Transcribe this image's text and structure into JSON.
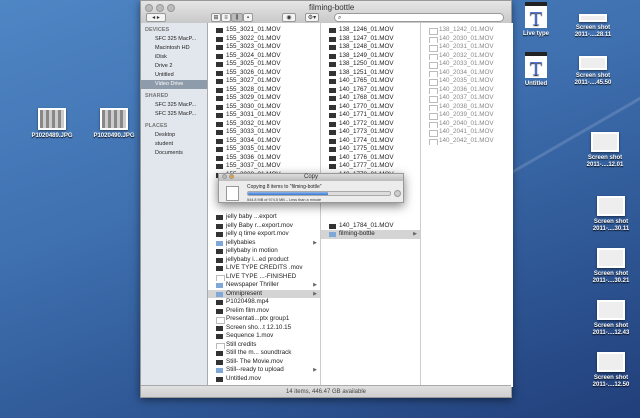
{
  "window": {
    "title": "filming-bottle",
    "status": "14 items, 446.47 GB available"
  },
  "sidebar": {
    "sections": [
      {
        "header": "DEVICES",
        "items": [
          "SFC 325 MacP...",
          "Macintosh HD",
          "iDisk",
          "Drive 2",
          "Untitled",
          "Video Drive"
        ],
        "selected": 5
      },
      {
        "header": "SHARED",
        "items": [
          "SFC 325 MacP...",
          "SFC 325 MacP..."
        ]
      },
      {
        "header": "PLACES",
        "items": [
          "Desktop",
          "student",
          "Documents"
        ]
      }
    ]
  },
  "columns": [
    {
      "rows": [
        {
          "i": 0,
          "t": "155_3021_01.MOV"
        },
        {
          "i": 1,
          "t": "155_3022_01.MOV"
        },
        {
          "i": 2,
          "t": "155_3023_01.MOV"
        },
        {
          "i": 3,
          "t": "155_3024_01.MOV"
        },
        {
          "i": 4,
          "t": "155_3025_01.MOV"
        },
        {
          "i": 5,
          "t": "155_3026_01.MOV"
        },
        {
          "i": 6,
          "t": "155_3027_01.MOV"
        },
        {
          "i": 7,
          "t": "155_3028_01.MOV"
        },
        {
          "i": 8,
          "t": "155_3029_01.MOV"
        },
        {
          "i": 9,
          "t": "155_3030_01.MOV"
        },
        {
          "i": 10,
          "t": "155_3031_01.MOV"
        },
        {
          "i": 11,
          "t": "155_3032_01.MOV"
        },
        {
          "i": 12,
          "t": "155_3033_01.MOV"
        },
        {
          "i": 13,
          "t": "155_3034_01.MOV"
        },
        {
          "i": 14,
          "t": "155_3035_01.MOV"
        },
        {
          "i": 15,
          "t": "155_3036_01.MOV"
        },
        {
          "i": 16,
          "t": "155_3037_01.MOV"
        },
        {
          "i": 17,
          "t": "155_3038_01.MOV"
        },
        {
          "i": 22,
          "t": "jelly baby ...export"
        },
        {
          "i": 23,
          "t": "jelly Baby r...export.mov"
        },
        {
          "i": 24,
          "t": "jelly q time export.mov"
        },
        {
          "i": 25,
          "t": "jellybabies",
          "folder": true
        },
        {
          "i": 26,
          "t": "jellybaby in motion"
        },
        {
          "i": 27,
          "t": "jellybaby i...ed product"
        },
        {
          "i": 28,
          "t": "LIVE TYPE CREDITS .mov"
        },
        {
          "i": 29,
          "t": "LIVE TYPE ...-FINISHED",
          "doc": true
        },
        {
          "i": 30,
          "t": "Newspaper Thriller",
          "folder": true
        },
        {
          "i": 31,
          "t": "Omnipresent",
          "folder": true,
          "sel": true
        },
        {
          "i": 32,
          "t": "P1020498.mp4"
        },
        {
          "i": 33,
          "t": "Prelim film.mov"
        },
        {
          "i": 34,
          "t": "Presentati...ptx group1",
          "doc": true
        },
        {
          "i": 35,
          "t": "Screen sho...t 12.10.15"
        },
        {
          "i": 36,
          "t": "Sequence 1.mov"
        },
        {
          "i": 37,
          "t": "Still credits",
          "doc": true
        },
        {
          "i": 38,
          "t": "Still the m... soundtrack"
        },
        {
          "i": 39,
          "t": "Still- The Movie.mov"
        },
        {
          "i": 40,
          "t": "Still--ready to upload",
          "folder": true
        },
        {
          "i": 41,
          "t": "Untitled.mov"
        }
      ]
    },
    {
      "rows": [
        {
          "i": 0,
          "t": "138_1246_01.MOV"
        },
        {
          "i": 1,
          "t": "138_1247_01.MOV"
        },
        {
          "i": 2,
          "t": "138_1248_01.MOV"
        },
        {
          "i": 3,
          "t": "138_1249_01.MOV"
        },
        {
          "i": 4,
          "t": "138_1250_01.MOV"
        },
        {
          "i": 5,
          "t": "138_1251_01.MOV"
        },
        {
          "i": 6,
          "t": "140_1765_01.MOV"
        },
        {
          "i": 7,
          "t": "140_1767_01.MOV"
        },
        {
          "i": 8,
          "t": "140_1768_01.MOV"
        },
        {
          "i": 9,
          "t": "140_1770_01.MOV"
        },
        {
          "i": 10,
          "t": "140_1771_01.MOV"
        },
        {
          "i": 11,
          "t": "140_1772_01.MOV"
        },
        {
          "i": 12,
          "t": "140_1773_01.MOV"
        },
        {
          "i": 13,
          "t": "140_1774_01.MOV"
        },
        {
          "i": 14,
          "t": "140_1775_01.MOV"
        },
        {
          "i": 15,
          "t": "140_1776_01.MOV"
        },
        {
          "i": 16,
          "t": "140_1777_01.MOV"
        },
        {
          "i": 17,
          "t": "140_1778_01.MOV"
        },
        {
          "i": 23,
          "t": "140_1784_01.MOV"
        },
        {
          "i": 24,
          "t": "filming-bottle",
          "folder": true,
          "sel": true
        }
      ]
    },
    {
      "rows": [
        {
          "i": 0,
          "t": "138_1242_01.MOV",
          "doc": true
        },
        {
          "i": 1,
          "t": "140_2030_01.MOV",
          "doc": true
        },
        {
          "i": 2,
          "t": "140_2031_01.MOV",
          "doc": true
        },
        {
          "i": 3,
          "t": "140_2032_01.MOV",
          "doc": true
        },
        {
          "i": 4,
          "t": "140_2033_01.MOV",
          "doc": true
        },
        {
          "i": 5,
          "t": "140_2034_01.MOV",
          "doc": true
        },
        {
          "i": 6,
          "t": "140_2035_01.MOV",
          "doc": true
        },
        {
          "i": 7,
          "t": "140_2036_01.MOV",
          "doc": true
        },
        {
          "i": 8,
          "t": "140_2037_01.MOV",
          "doc": true
        },
        {
          "i": 9,
          "t": "140_2038_01.MOV",
          "doc": true
        },
        {
          "i": 10,
          "t": "140_2039_01.MOV",
          "doc": true
        },
        {
          "i": 11,
          "t": "140_2040_01.MOV",
          "doc": true
        },
        {
          "i": 12,
          "t": "140_2041_01.MOV",
          "doc": true
        },
        {
          "i": 13,
          "t": "140_2042_01.MOV",
          "doc": true
        }
      ]
    }
  ],
  "copy_dialog": {
    "title": "Copy",
    "message": "Copying 8 items to “filming-bottle”",
    "detail": "544.8 MB of 974.5 MB – Less than a minute",
    "progress_percent": 56
  },
  "desktop": {
    "left": [
      {
        "name": "P1020489.JPG"
      },
      {
        "name": "P1020490.JPG"
      }
    ],
    "right": [
      {
        "l1": "Live type",
        "type": "livetype"
      },
      {
        "l1": "Screen shot",
        "l2": "2011-....28.11"
      },
      {
        "l1": "Untitled",
        "type": "livetype"
      },
      {
        "l1": "Screen shot",
        "l2": "2011-....45.50"
      },
      {
        "l1": "Screen shot",
        "l2": "2011-....12.01"
      },
      {
        "l1": "Screen shot",
        "l2": "2011-....30.11"
      },
      {
        "l1": "Screen shot",
        "l2": "2011-....30.21"
      },
      {
        "l1": "Screen shot",
        "l2": "2011-....12.43"
      },
      {
        "l1": "Screen shot",
        "l2": "2011-....12.50"
      }
    ]
  }
}
